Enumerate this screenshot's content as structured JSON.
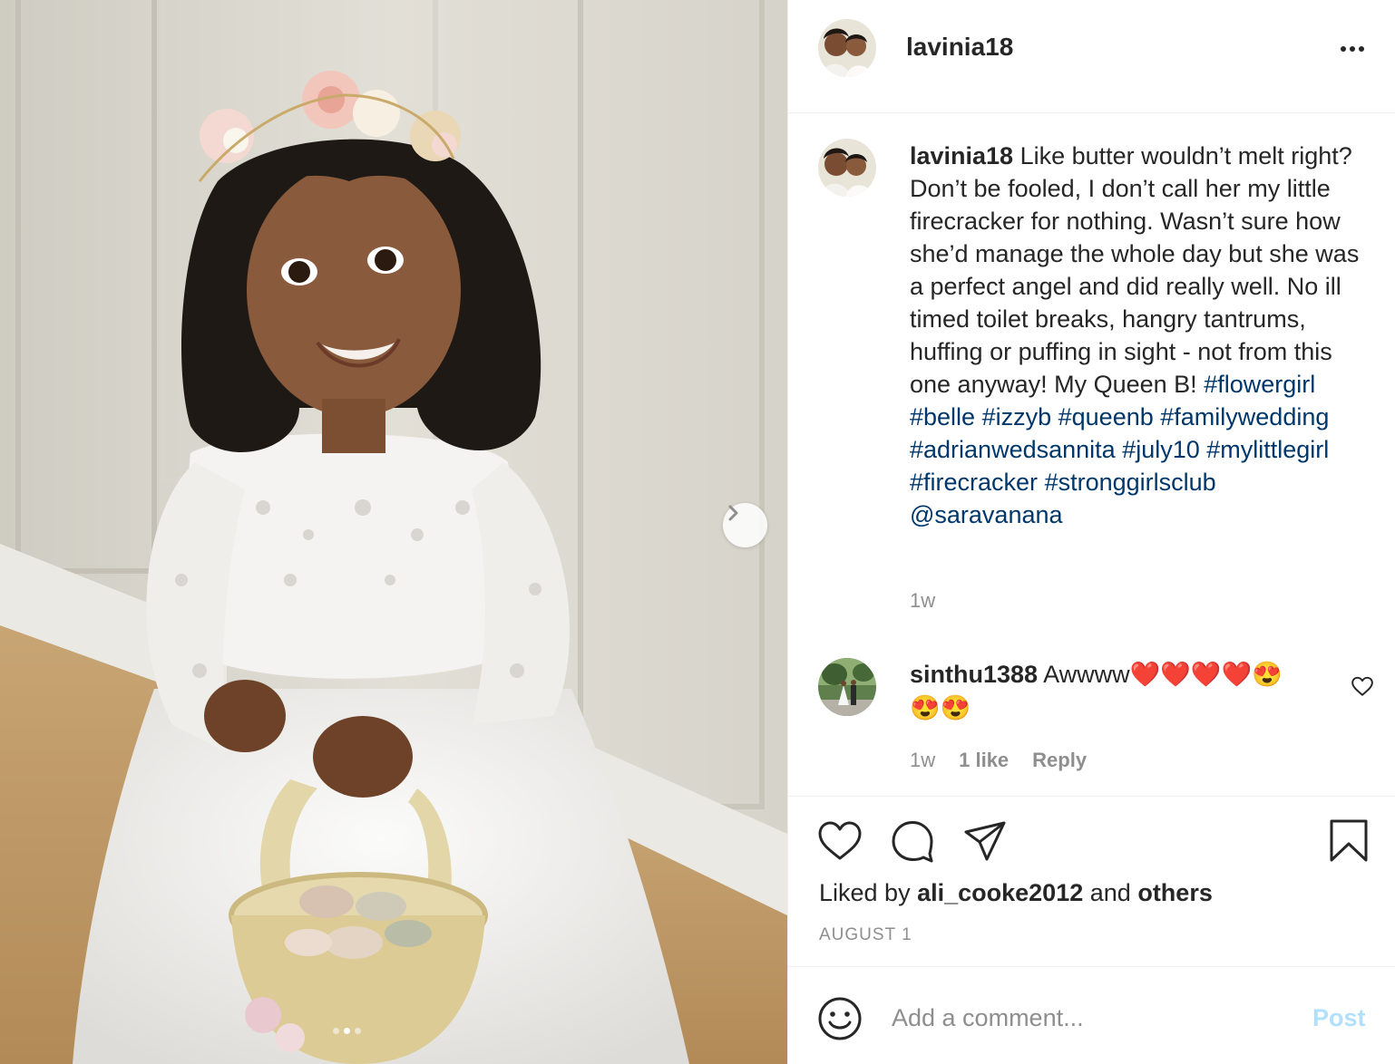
{
  "post": {
    "username": "lavinia18",
    "caption_username": "lavinia18",
    "caption_text": "Like butter wouldn’t melt right? Don’t be fooled, I don’t call her my little firecracker for nothing. Wasn’t sure how she’d manage the whole day but she was a perfect angel and did really well. No ill timed toilet breaks, hangry tantrums, huffing or puffing in sight - not from this one anyway! My Queen B!",
    "hashtags": [
      "#flowergirl",
      "#belle",
      "#izzyb",
      "#queenb",
      "#familywedding",
      "#adrianwedsannita",
      "#july10",
      "#mylittlegirl",
      "#firecracker",
      "#stronggirlsclub"
    ],
    "mention": "@saravanana",
    "caption_time": "1w"
  },
  "comment": {
    "username": "sinthu1388",
    "text": "Awwww❤️❤️❤️❤️😍😍😍",
    "time": "1w",
    "likes": "1 like",
    "reply_label": "Reply"
  },
  "likes": {
    "prefix": "Liked by",
    "user": "ali_cooke2012",
    "middle": "and",
    "others": "others"
  },
  "date": "AUGUST 1",
  "comment_box": {
    "placeholder": "Add a comment...",
    "post_label": "Post"
  },
  "carousel": {
    "total": 2,
    "active": 1
  },
  "colors": {
    "link": "#00376b",
    "muted": "#8e8e8e",
    "post_disabled": "#b2dffc"
  }
}
